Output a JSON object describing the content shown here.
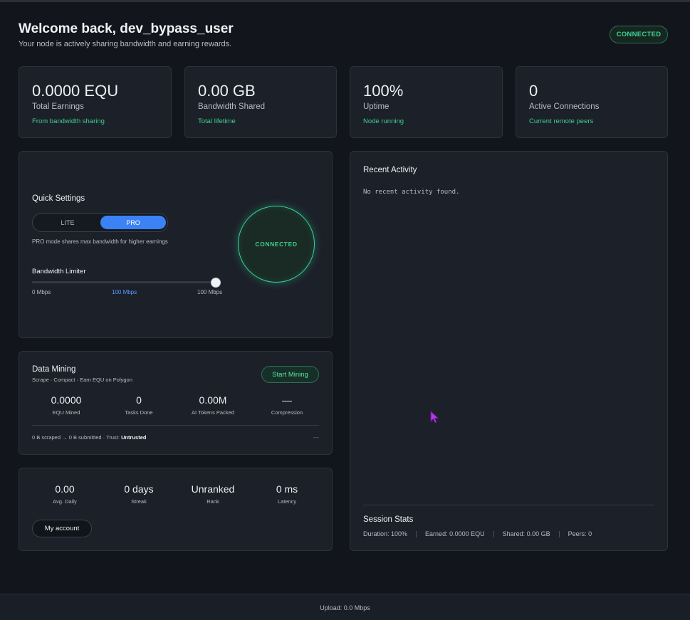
{
  "header": {
    "title": "Welcome back, dev_bypass_user",
    "subtitle": "Your node is actively sharing bandwidth and earning rewards.",
    "status_badge": "CONNECTED",
    "status_color": "#3fd29a"
  },
  "stats": [
    {
      "value": "0.0000 EQU",
      "label": "Total Earnings",
      "note": "From bandwidth sharing"
    },
    {
      "value": "0.00 GB",
      "label": "Bandwidth Shared",
      "note": "Total lifetime"
    },
    {
      "value": "100%",
      "label": "Uptime",
      "note": "Node running"
    },
    {
      "value": "0",
      "label": "Active Connections",
      "note": "Current remote peers"
    }
  ],
  "quick_settings": {
    "title": "Quick Settings",
    "mode_lite": "LITE",
    "mode_pro": "PRO",
    "selected_mode": "PRO",
    "mode_note": "PRO mode shares max bandwidth for higher earnings",
    "bandwidth_title": "Bandwidth Limiter",
    "bandwidth_min": "0 Mbps",
    "bandwidth_current": "100 Mbps",
    "bandwidth_max": "100 Mbps",
    "bandwidth_level": 1.0,
    "ring_status": "CONNECTED"
  },
  "recent_activity": {
    "title": "Recent Activity",
    "empty": "No recent activity found."
  },
  "session_stats": {
    "title": "Session Stats",
    "items": [
      "Duration: 100%",
      "Earned: 0.0000 EQU",
      "Shared: 0.00 GB",
      "Peers: 0"
    ]
  },
  "data_mining": {
    "title": "Data Mining",
    "subtitle": "Scrape · Compact · Earn EQU on Polygon",
    "button": "Start Mining",
    "metrics": [
      {
        "value": "0.0000",
        "label": "EQU Mined"
      },
      {
        "value": "0",
        "label": "Tasks Done"
      },
      {
        "value": "0.00M",
        "label": "AI Tokens Packed"
      },
      {
        "value": "—",
        "label": "Compression"
      }
    ],
    "footer_text": "0 B scraped → 0 B submitted · Trust: ",
    "trust": "Untrusted",
    "footer_dash": "—"
  },
  "account_stats": {
    "metrics": [
      {
        "value": "0.00",
        "label": "Avg. Daily"
      },
      {
        "value": "0 days",
        "label": "Streak"
      },
      {
        "value": "Unranked",
        "label": "Rank"
      },
      {
        "value": "0 ms",
        "label": "Latency"
      }
    ],
    "button": "My account"
  },
  "footer": {
    "upload": "Upload: 0.0 Mbps"
  },
  "colors": {
    "accent_green": "#3fcf8e",
    "accent_blue": "#3b82f6",
    "background": "#12151c",
    "card": "#1c2029"
  }
}
